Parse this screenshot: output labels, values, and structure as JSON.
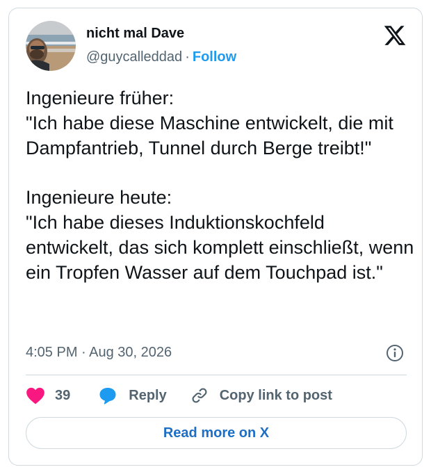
{
  "author": {
    "display_name": "nicht mal Dave",
    "handle": "@guycalleddad",
    "separator": "·",
    "follow_label": "Follow",
    "avatar_icon": "profile-photo-beach"
  },
  "brand": {
    "logo_icon": "x-logo"
  },
  "tweet": {
    "text": "Ingenieure früher:\n\"Ich habe diese Maschine entwickelt, die mit Dampfantrieb, Tunnel durch Berge treibt!\"\n\nIngenieure heute:\n\"Ich habe dieses Induktionskochfeld entwickelt, das sich komplett einschließt, wenn ein Tropfen Wasser auf dem Touchpad ist.\"",
    "timestamp": "4:05 PM · Aug 30, 2026",
    "info_icon": "info-icon"
  },
  "actions": {
    "like_count": "39",
    "reply_label": "Reply",
    "copy_link_label": "Copy link to post"
  },
  "read_more_label": "Read more on X",
  "colors": {
    "like": "#f91880",
    "reply": "#1d9bf0",
    "link": "#1d9bf0",
    "border": "#cfd9de",
    "muted": "#536471"
  }
}
